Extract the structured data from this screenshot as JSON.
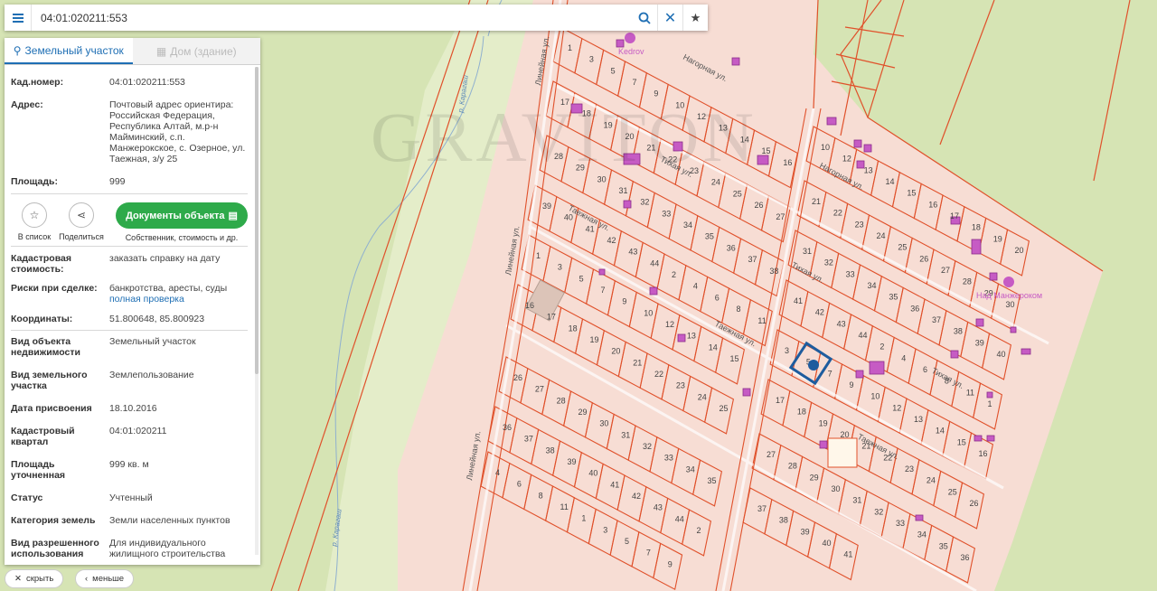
{
  "search": {
    "value": "04:01:020211:553"
  },
  "tabs": [
    {
      "label": "Земельный участок"
    },
    {
      "label": "Дом (здание)"
    }
  ],
  "details": {
    "cad_number": {
      "label": "Кад.номер:",
      "value": "04:01:020211:553"
    },
    "address": {
      "label": "Адрес:",
      "lines": [
        "Почтовый адрес ориентира:",
        "Российская Федерация,",
        "Республика Алтай, м.р-н",
        "Майминский, с.п.",
        "Манжерокское, с. Озерное, ул.",
        "Таежная, з/у 25"
      ]
    },
    "area": {
      "label": "Площадь:",
      "value": "999"
    },
    "cad_cost": {
      "label_lines": [
        "Кадастровая",
        "стоимость:"
      ],
      "value": "заказать справку на дату"
    },
    "risks": {
      "label": "Риски при сделке:",
      "value": "банкротства, аресты, суды",
      "link": "полная проверка"
    },
    "coords": {
      "label": "Координаты:",
      "value": "51.800648, 85.800923"
    },
    "object_type": {
      "label_lines": [
        "Вид объекта",
        "недвижимости"
      ],
      "value": "Земельный участок"
    },
    "parcel_type": {
      "label_lines": [
        "Вид земельного",
        "участка"
      ],
      "value": "Землепользование"
    },
    "assigned_date": {
      "label": "Дата присвоения",
      "value": "18.10.2016"
    },
    "cad_quarter": {
      "label_lines": [
        "Кадастровый",
        "квартал"
      ],
      "value": "04:01:020211"
    },
    "precise_area": {
      "label": "Площадь уточненная",
      "value": "999 кв. м"
    },
    "status": {
      "label": "Статус",
      "value": "Учтенный"
    },
    "land_category": {
      "label": "Категория земель",
      "value": "Земли населенных пунктов"
    },
    "permitted_use": {
      "label_lines": [
        "Вид разрешенного",
        "использования"
      ],
      "value_lines": [
        "Для индивидуального",
        "жилищного строительства"
      ]
    }
  },
  "actions": {
    "add_to_list": "В список",
    "share": "Поделиться",
    "docs_button": "Документы объекта",
    "docs_sub": "Собственник, стоимость и др."
  },
  "bottom": {
    "hide": "скрыть",
    "less": "меньше"
  },
  "map": {
    "watermark": "GRAVITON",
    "streets": [
      "Линейная ул.",
      "Нагорная ул.",
      "Тихая ул.",
      "Таежная ул.",
      "Линейная ул.",
      "Нагорная ул.",
      "Тихая ул.",
      "Таежная ул.",
      "Линейная ул."
    ],
    "rivers": [
      "р. Карагаш",
      "р. Карагаш"
    ],
    "pois": [
      "Kedrov",
      "Над Манжероком"
    ],
    "parcel_numbers": [
      "1",
      "3",
      "5",
      "7",
      "9",
      "10",
      "12",
      "13",
      "14",
      "15",
      "16",
      "17",
      "18",
      "19",
      "20",
      "21",
      "22",
      "23",
      "24",
      "25",
      "26",
      "27",
      "28",
      "29",
      "30",
      "31",
      "32",
      "33",
      "34",
      "35",
      "36",
      "37",
      "38",
      "39",
      "40",
      "41",
      "42",
      "43",
      "44",
      "2",
      "4",
      "6",
      "8",
      "11"
    ],
    "colors": {
      "parcel_fill": "#f7ddd4",
      "parcel_border": "#e0512b",
      "forest": "#d6e4b4",
      "accent": "#1f6fb4",
      "button_green": "#2eaa4a"
    }
  }
}
